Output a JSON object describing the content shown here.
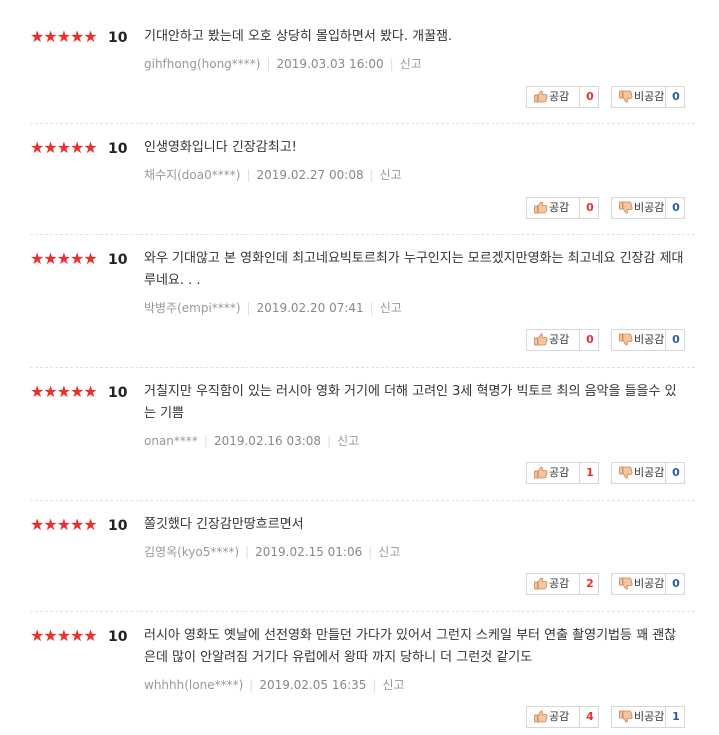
{
  "reviews": [
    {
      "stars": "★★★★★",
      "score": "10",
      "text": "기대안하고 봤는데 오호 상당히 몰입하면서 봤다. 개꿀잼.",
      "user": "gihfhong(hong****)",
      "date": "2019.03.03 16:00",
      "report": "신고",
      "like_label": "공감",
      "like_count": "0",
      "dislike_label": "비공감",
      "dislike_count": "0"
    },
    {
      "stars": "★★★★★",
      "score": "10",
      "text": "인생영화입니다 긴장감최고!",
      "user": "채수지(doa0****)",
      "date": "2019.02.27 00:08",
      "report": "신고",
      "like_label": "공감",
      "like_count": "0",
      "dislike_label": "비공감",
      "dislike_count": "0"
    },
    {
      "stars": "★★★★★",
      "score": "10",
      "text": "와우 기대않고 본 영화인데 최고네요빅토르최가 누구인지는 모르겠지만영화는 최고네요 긴장감 제대루네요. . .",
      "user": "박병주(empi****)",
      "date": "2019.02.20 07:41",
      "report": "신고",
      "like_label": "공감",
      "like_count": "0",
      "dislike_label": "비공감",
      "dislike_count": "0"
    },
    {
      "stars": "★★★★★",
      "score": "10",
      "text": "거칠지만 우직함이 있는 러시아 영화 거기에 더해 고려인 3세 혁명가 빅토르 최의 음악을 들을수 있는 기쁨",
      "user": "onan****",
      "date": "2019.02.16 03:08",
      "report": "신고",
      "like_label": "공감",
      "like_count": "1",
      "dislike_label": "비공감",
      "dislike_count": "0"
    },
    {
      "stars": "★★★★★",
      "score": "10",
      "text": "쫄깃했다 긴장감만땅흐르면서",
      "user": "김영옥(kyo5****)",
      "date": "2019.02.15 01:06",
      "report": "신고",
      "like_label": "공감",
      "like_count": "2",
      "dislike_label": "비공감",
      "dislike_count": "0"
    },
    {
      "stars": "★★★★★",
      "score": "10",
      "text": "러시아 영화도 옛날에 선전영화 만들던 가다가 있어서 그런지 스케일 부터 연출 촬영기법등 꽤 괜찮은데 많이 안알려짐 거기다 유럽에서 왕따 까지 당하니 더 그런것 같기도",
      "user": "whhhh(lone****)",
      "date": "2019.02.05 16:35",
      "report": "신고",
      "like_label": "공감",
      "like_count": "4",
      "dislike_label": "비공감",
      "dislike_count": "1"
    }
  ]
}
